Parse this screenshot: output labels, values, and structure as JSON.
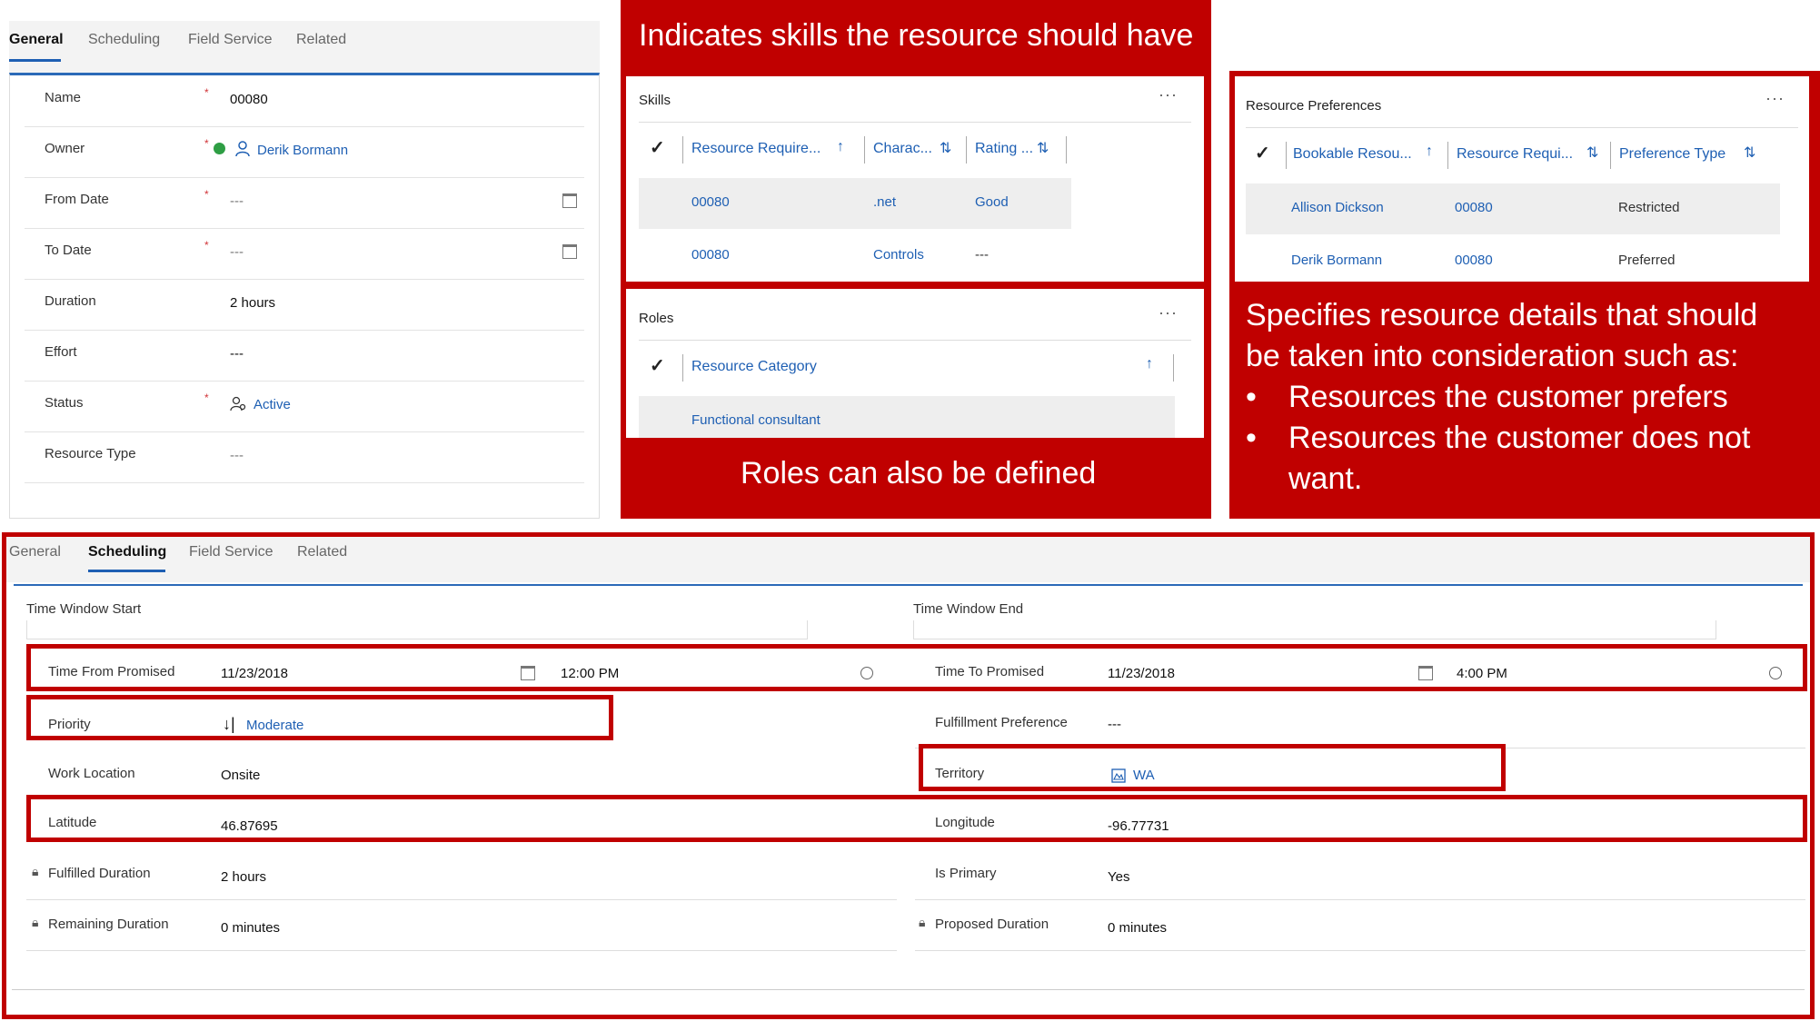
{
  "general_panel": {
    "tabs": [
      {
        "label": "General"
      },
      {
        "label": "Scheduling"
      },
      {
        "label": "Field Service"
      },
      {
        "label": "Related"
      }
    ],
    "fields": [
      {
        "label": "Name",
        "required": "*",
        "value": "00080"
      },
      {
        "label": "Owner",
        "required": "*",
        "value": "Derik Bormann"
      },
      {
        "label": "From Date",
        "required": "*",
        "value": "---"
      },
      {
        "label": "To Date",
        "required": "*",
        "value": "---"
      },
      {
        "label": "Duration",
        "value": "2 hours"
      },
      {
        "label": "Effort",
        "value": "---"
      },
      {
        "label": "Status",
        "required": "*",
        "value": "Active"
      },
      {
        "label": "Resource Type",
        "value": "---"
      }
    ]
  },
  "skills_callout": {
    "heading": "Indicates skills the resource should have",
    "skills": {
      "title": "Skills",
      "more": "···",
      "columns": [
        "Resource Require...",
        "Charac...",
        "Rating ..."
      ],
      "rows": [
        [
          "00080",
          ".net",
          "Good"
        ],
        [
          "00080",
          "Controls",
          "---"
        ]
      ]
    },
    "roles": {
      "title": "Roles",
      "more": "···",
      "column": "Resource Category",
      "rows": [
        "Functional consultant"
      ]
    },
    "footer": "Roles can also be defined"
  },
  "preferences_callout": {
    "title": "Resource Preferences",
    "more": "···",
    "columns": [
      "Bookable Resou...",
      "Resource Requi...",
      "Preference Type"
    ],
    "rows": [
      [
        "Allison Dickson",
        "00080",
        "Restricted"
      ],
      [
        "Derik Bormann",
        "00080",
        "Preferred"
      ]
    ],
    "note_line1": "Specifies resource details that should",
    "note_line2": "be taken into consideration such as:",
    "bullet1": "Resources the customer prefers",
    "bullet2_line1": "Resources the customer does not",
    "bullet2_line2": "want."
  },
  "scheduling_panel": {
    "tabs": [
      {
        "label": "General"
      },
      {
        "label": "Scheduling"
      },
      {
        "label": "Field Service"
      },
      {
        "label": "Related"
      }
    ],
    "time_window_start": "Time Window Start",
    "time_window_end": "Time Window End",
    "time_from_promised": {
      "label": "Time From Promised",
      "date": "11/23/2018",
      "time": "12:00 PM"
    },
    "time_to_promised": {
      "label": "Time To Promised",
      "date": "11/23/2018",
      "time": "4:00 PM"
    },
    "priority": {
      "label": "Priority",
      "value": "Moderate"
    },
    "fulfillment_preference": {
      "label": "Fulfillment Preference",
      "value": "---"
    },
    "work_location": {
      "label": "Work Location",
      "value": "Onsite"
    },
    "territory": {
      "label": "Territory",
      "value": "WA"
    },
    "latitude": {
      "label": "Latitude",
      "value": "46.87695"
    },
    "longitude": {
      "label": "Longitude",
      "value": "-96.77731"
    },
    "fulfilled_duration": {
      "label": "Fulfilled Duration",
      "value": "2 hours"
    },
    "is_primary": {
      "label": "Is Primary",
      "value": "Yes"
    },
    "remaining_duration": {
      "label": "Remaining Duration",
      "value": "0 minutes"
    },
    "proposed_duration": {
      "label": "Proposed Duration",
      "value": "0 minutes"
    }
  },
  "icons": [
    "calendar-icon",
    "clock-icon",
    "user-icon",
    "status-icon",
    "sort-icon",
    "lock-icon",
    "territory-icon",
    "check-icon"
  ],
  "colors": {
    "accent_red": "#c00000",
    "link_blue": "#1e5fb3",
    "tab_blue": "#2b6ab8"
  }
}
